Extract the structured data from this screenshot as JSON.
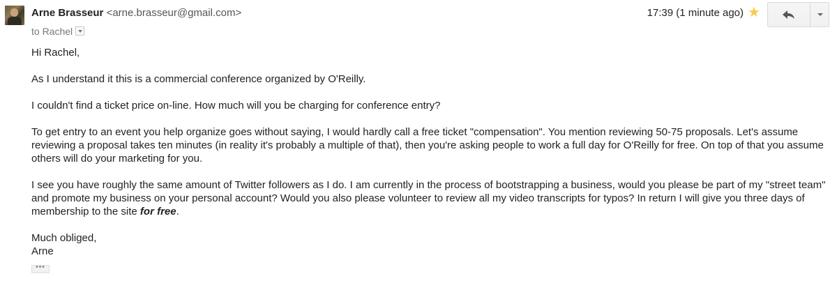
{
  "header": {
    "sender_name": "Arne Brasseur",
    "sender_email": "<arne.brasseur@gmail.com>",
    "to_label": "to Rachel",
    "timestamp": "17:39 (1 minute ago)",
    "starred": true,
    "star_color": "#f7cb4d"
  },
  "icons": {
    "star": "star-icon",
    "reply": "reply-arrow-icon",
    "more": "chevron-down-icon",
    "details": "details-dropdown-icon"
  },
  "body": {
    "greeting": "Hi Rachel,",
    "p1": "As I understand it this is a commercial conference organized by O'Reilly.",
    "p2": "I couldn't find a ticket price on-line. How much will you be charging for conference entry?",
    "p3": "To get entry to an event you help organize goes without saying, I would hardly call a free ticket \"compensation\". You mention reviewing 50-75 proposals. Let's assume reviewing a proposal takes ten minutes (in reality it's probably a multiple of that), then you're asking people to work a full day for O'Reilly for free. On top of that you assume others will do your marketing for you.",
    "p4_before": "I see you have roughly the same amount of Twitter followers as I do. I am currently in the process of bootstrapping a business, would you please be part of my \"street team\" and promote my business on your personal account? Would you also please volunteer to review all my video transcripts for typos? In return I will give you three days of membership to the site ",
    "p4_emphasis": "for free",
    "p4_after": ".",
    "signoff": "Much obliged,",
    "signature": "Arne"
  },
  "footer": {
    "show_trimmed_label": "•••"
  }
}
